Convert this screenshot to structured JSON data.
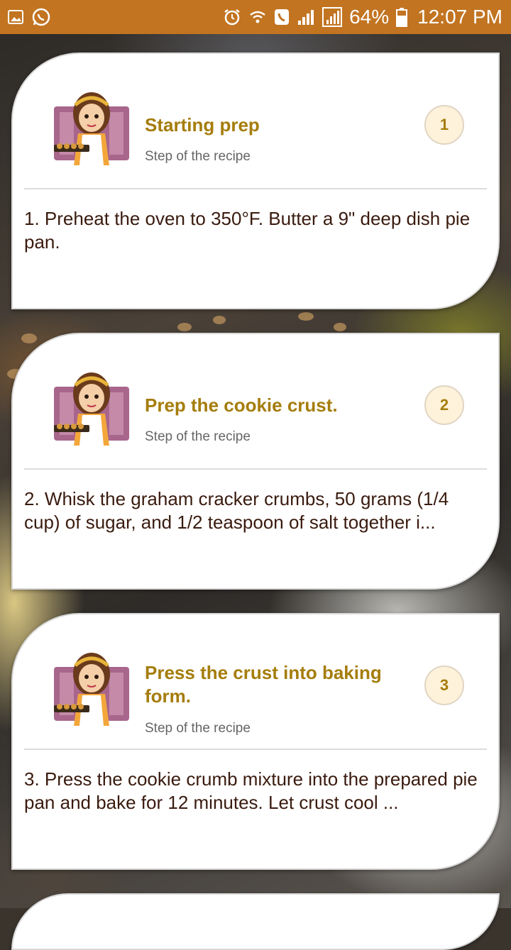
{
  "status_bar": {
    "battery": "64%",
    "time": "12:07 PM"
  },
  "cards": [
    {
      "title": "Starting prep",
      "subtitle": "Step of the recipe",
      "number": "1",
      "text": "1. Preheat the oven to 350°F. Butter a 9\" deep dish pie pan."
    },
    {
      "title": "Prep the cookie crust.",
      "subtitle": "Step of the recipe",
      "number": "2",
      "text": "2. Whisk the graham cracker crumbs, 50 grams (1/4 cup) of sugar, and 1/2 teaspoon of salt together i..."
    },
    {
      "title": "Press the crust into baking form.",
      "subtitle": "Step of the recipe",
      "number": "3",
      "text": "3. Press the cookie crumb mixture into the prepared pie pan and bake for 12 minutes. Let crust cool ..."
    }
  ],
  "colors": {
    "status_bar": "#c27421",
    "title": "#a57d0c",
    "body_text": "#3a1b0f",
    "badge_bg": "#fff2da"
  }
}
